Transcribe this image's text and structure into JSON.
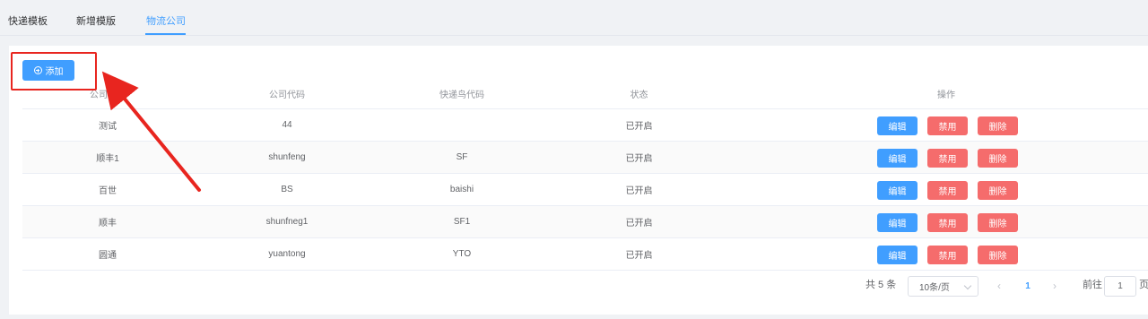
{
  "tabs": [
    {
      "label": "快递模板"
    },
    {
      "label": "新增模版"
    },
    {
      "label": "物流公司"
    }
  ],
  "toolbar": {
    "add_label": "添加"
  },
  "table": {
    "headers": [
      "公司名称",
      "公司代码",
      "快递鸟代码",
      "状态",
      "操作"
    ],
    "rows": [
      {
        "name": "测试",
        "code": "44",
        "kdn_code": "",
        "status": "已开启"
      },
      {
        "name": "顺丰1",
        "code": "shunfeng",
        "kdn_code": "SF",
        "status": "已开启"
      },
      {
        "name": "百世",
        "code": "BS",
        "kdn_code": "baishi",
        "status": "已开启"
      },
      {
        "name": "顺丰",
        "code": "shunfneg1",
        "kdn_code": "SF1",
        "status": "已开启"
      },
      {
        "name": "圆通",
        "code": "yuantong",
        "kdn_code": "YTO",
        "status": "已开启"
      }
    ],
    "actions": {
      "edit": "编辑",
      "disable": "禁用",
      "delete": "删除"
    }
  },
  "pagination": {
    "total": "共 5 条",
    "page_size": "10条/页",
    "current_page": "1",
    "goto_label": "前往",
    "goto_value": "1",
    "page_suffix": "页"
  },
  "colors": {
    "primary": "#409eff",
    "danger": "#f56c6c",
    "annotation": "#e8251f"
  },
  "icons": {
    "add": "plus-circle-icon",
    "prev": "chevron-left-icon",
    "next": "chevron-right-icon",
    "caret": "chevron-down-icon"
  }
}
